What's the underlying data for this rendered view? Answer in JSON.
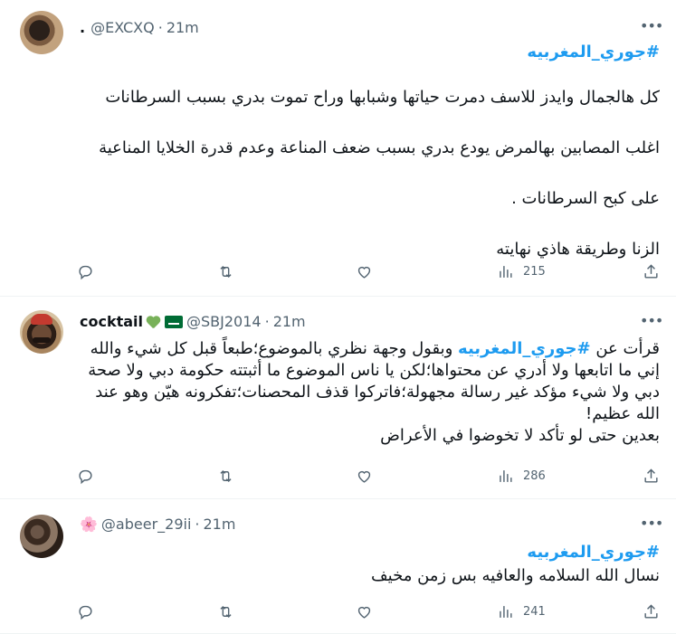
{
  "tweets": [
    {
      "display_name": ".",
      "handle": "@EXCXQ",
      "separator": "·",
      "time": "21m",
      "hashtag": "#جوري_المغربيه",
      "paragraphs": [
        "كل هالجمال وايدز للاسف دمرت حياتها وشبابها وراح تموت بدري بسبب السرطانات",
        "اغلب المصابين بهالمرض يودع بدري بسبب ضعف المناعة وعدم قدرة الخلايا المناعية",
        "على كبح السرطانات .",
        "الزنا وطريقة هاذي نهايته"
      ],
      "views": "215"
    },
    {
      "display_name": "cocktail",
      "handle": "@SBJ2014",
      "separator": "·",
      "time": "21m",
      "hashtag": "#جوري_المغربيه",
      "text_before": "قرأت عن",
      "text_after": "وبقول وجهة نظري بالموضوع؛طبعاً قبل كل شيء والله إني ما اتابعها ولا أدري عن محتواها؛لكن يا ناس الموضوع ما أثبتته حكومة دبي ولا صحة دبي ولا شيء مؤكد غير رسالة مجهولة؛فاتركوا قذف المحصنات؛تفكرونه هيّن وهو عند الله عظيم!",
      "last_line": "بعدين حتى لو تأكد لا تخوضوا في الأعراض",
      "views": "286"
    },
    {
      "display_name": "🌸",
      "handle": "@abeer_29ii",
      "separator": "·",
      "time": "21m",
      "hashtag": "#جوري_المغربيه",
      "text": "نسال الله السلامه والعافيه بس زمن مخيف",
      "views": "241"
    }
  ],
  "icons": {
    "more": "more-horizontal-icon",
    "reply": "reply-icon",
    "retweet": "retweet-icon",
    "like": "heart-icon",
    "views": "views-chart-icon",
    "share": "share-icon"
  },
  "colors": {
    "link": "#1d9bf0",
    "secondary_text": "#536471",
    "primary_text": "#0f1419",
    "divider": "#eff3f4"
  }
}
